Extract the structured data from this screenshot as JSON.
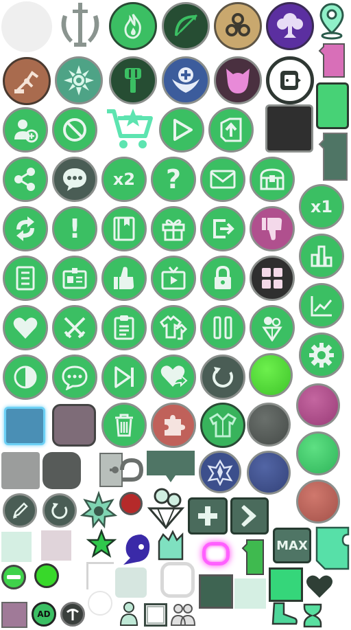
{
  "labels": {
    "x2": "x2",
    "x1": "x1",
    "max": "MAX",
    "ad": "AD"
  },
  "colors": {
    "green": "#3bbf63",
    "dark_green": "#264d33",
    "slate": "#4a5d55",
    "pink": "#b0508e",
    "blue": "#3c4f8c",
    "red": "#c0615a"
  }
}
